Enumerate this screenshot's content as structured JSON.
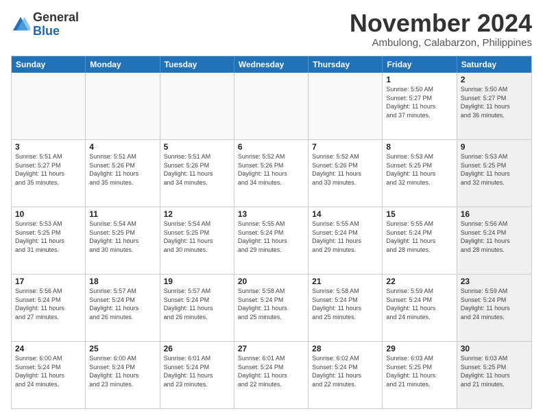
{
  "logo": {
    "general": "General",
    "blue": "Blue"
  },
  "title": "November 2024",
  "location": "Ambulong, Calabarzon, Philippines",
  "weekdays": [
    "Sunday",
    "Monday",
    "Tuesday",
    "Wednesday",
    "Thursday",
    "Friday",
    "Saturday"
  ],
  "weeks": [
    [
      {
        "day": "",
        "info": "",
        "empty": true
      },
      {
        "day": "",
        "info": "",
        "empty": true
      },
      {
        "day": "",
        "info": "",
        "empty": true
      },
      {
        "day": "",
        "info": "",
        "empty": true
      },
      {
        "day": "",
        "info": "",
        "empty": true
      },
      {
        "day": "1",
        "info": "Sunrise: 5:50 AM\nSunset: 5:27 PM\nDaylight: 11 hours\nand 37 minutes.",
        "shaded": false
      },
      {
        "day": "2",
        "info": "Sunrise: 5:50 AM\nSunset: 5:27 PM\nDaylight: 11 hours\nand 36 minutes.",
        "shaded": true
      }
    ],
    [
      {
        "day": "3",
        "info": "Sunrise: 5:51 AM\nSunset: 5:27 PM\nDaylight: 11 hours\nand 35 minutes.",
        "shaded": false
      },
      {
        "day": "4",
        "info": "Sunrise: 5:51 AM\nSunset: 5:26 PM\nDaylight: 11 hours\nand 35 minutes.",
        "shaded": false
      },
      {
        "day": "5",
        "info": "Sunrise: 5:51 AM\nSunset: 5:26 PM\nDaylight: 11 hours\nand 34 minutes.",
        "shaded": false
      },
      {
        "day": "6",
        "info": "Sunrise: 5:52 AM\nSunset: 5:26 PM\nDaylight: 11 hours\nand 34 minutes.",
        "shaded": false
      },
      {
        "day": "7",
        "info": "Sunrise: 5:52 AM\nSunset: 5:26 PM\nDaylight: 11 hours\nand 33 minutes.",
        "shaded": false
      },
      {
        "day": "8",
        "info": "Sunrise: 5:53 AM\nSunset: 5:25 PM\nDaylight: 11 hours\nand 32 minutes.",
        "shaded": false
      },
      {
        "day": "9",
        "info": "Sunrise: 5:53 AM\nSunset: 5:25 PM\nDaylight: 11 hours\nand 32 minutes.",
        "shaded": true
      }
    ],
    [
      {
        "day": "10",
        "info": "Sunrise: 5:53 AM\nSunset: 5:25 PM\nDaylight: 11 hours\nand 31 minutes.",
        "shaded": false
      },
      {
        "day": "11",
        "info": "Sunrise: 5:54 AM\nSunset: 5:25 PM\nDaylight: 11 hours\nand 30 minutes.",
        "shaded": false
      },
      {
        "day": "12",
        "info": "Sunrise: 5:54 AM\nSunset: 5:25 PM\nDaylight: 11 hours\nand 30 minutes.",
        "shaded": false
      },
      {
        "day": "13",
        "info": "Sunrise: 5:55 AM\nSunset: 5:24 PM\nDaylight: 11 hours\nand 29 minutes.",
        "shaded": false
      },
      {
        "day": "14",
        "info": "Sunrise: 5:55 AM\nSunset: 5:24 PM\nDaylight: 11 hours\nand 29 minutes.",
        "shaded": false
      },
      {
        "day": "15",
        "info": "Sunrise: 5:55 AM\nSunset: 5:24 PM\nDaylight: 11 hours\nand 28 minutes.",
        "shaded": false
      },
      {
        "day": "16",
        "info": "Sunrise: 5:56 AM\nSunset: 5:24 PM\nDaylight: 11 hours\nand 28 minutes.",
        "shaded": true
      }
    ],
    [
      {
        "day": "17",
        "info": "Sunrise: 5:56 AM\nSunset: 5:24 PM\nDaylight: 11 hours\nand 27 minutes.",
        "shaded": false
      },
      {
        "day": "18",
        "info": "Sunrise: 5:57 AM\nSunset: 5:24 PM\nDaylight: 11 hours\nand 26 minutes.",
        "shaded": false
      },
      {
        "day": "19",
        "info": "Sunrise: 5:57 AM\nSunset: 5:24 PM\nDaylight: 11 hours\nand 26 minutes.",
        "shaded": false
      },
      {
        "day": "20",
        "info": "Sunrise: 5:58 AM\nSunset: 5:24 PM\nDaylight: 11 hours\nand 25 minutes.",
        "shaded": false
      },
      {
        "day": "21",
        "info": "Sunrise: 5:58 AM\nSunset: 5:24 PM\nDaylight: 11 hours\nand 25 minutes.",
        "shaded": false
      },
      {
        "day": "22",
        "info": "Sunrise: 5:59 AM\nSunset: 5:24 PM\nDaylight: 11 hours\nand 24 minutes.",
        "shaded": false
      },
      {
        "day": "23",
        "info": "Sunrise: 5:59 AM\nSunset: 5:24 PM\nDaylight: 11 hours\nand 24 minutes.",
        "shaded": true
      }
    ],
    [
      {
        "day": "24",
        "info": "Sunrise: 6:00 AM\nSunset: 5:24 PM\nDaylight: 11 hours\nand 24 minutes.",
        "shaded": false
      },
      {
        "day": "25",
        "info": "Sunrise: 6:00 AM\nSunset: 5:24 PM\nDaylight: 11 hours\nand 23 minutes.",
        "shaded": false
      },
      {
        "day": "26",
        "info": "Sunrise: 6:01 AM\nSunset: 5:24 PM\nDaylight: 11 hours\nand 23 minutes.",
        "shaded": false
      },
      {
        "day": "27",
        "info": "Sunrise: 6:01 AM\nSunset: 5:24 PM\nDaylight: 11 hours\nand 22 minutes.",
        "shaded": false
      },
      {
        "day": "28",
        "info": "Sunrise: 6:02 AM\nSunset: 5:24 PM\nDaylight: 11 hours\nand 22 minutes.",
        "shaded": false
      },
      {
        "day": "29",
        "info": "Sunrise: 6:03 AM\nSunset: 5:25 PM\nDaylight: 11 hours\nand 21 minutes.",
        "shaded": false
      },
      {
        "day": "30",
        "info": "Sunrise: 6:03 AM\nSunset: 5:25 PM\nDaylight: 11 hours\nand 21 minutes.",
        "shaded": true
      }
    ]
  ]
}
